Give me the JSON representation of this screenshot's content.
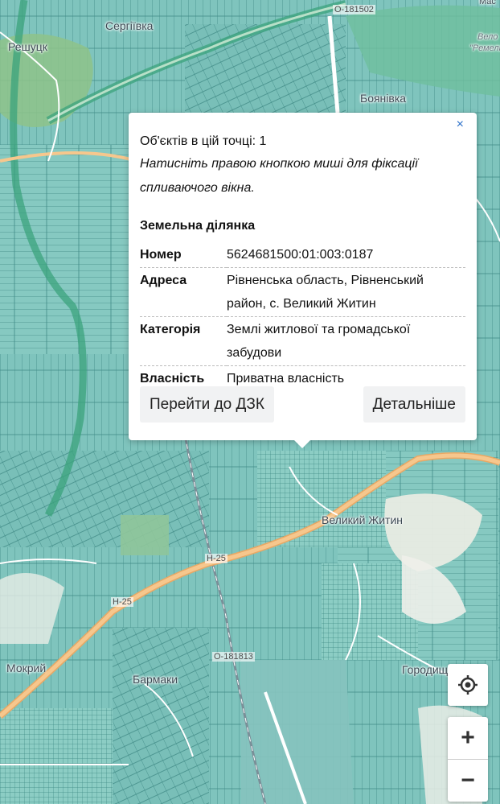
{
  "popup": {
    "close_label": "×",
    "count_text": "Об'єктів в цій точці: 1",
    "hint_text": "Натисніть правою кнопкою миші для фіксації спливаючого вікна.",
    "section_title": "Земельна ділянка",
    "attributes": [
      {
        "key": "Номер",
        "value": "5624681500:01:003:0187"
      },
      {
        "key": "Адреса",
        "value": "Рівненська область, Рівненський район, с. Великий Житин"
      },
      {
        "key": "Категорія",
        "value": "Землі житлової та громадської забудови"
      },
      {
        "key": "Власність",
        "value": "Приватна власність"
      }
    ],
    "buttons": {
      "go_dzk": "Перейти до ДЗК",
      "details": "Детальніше"
    }
  },
  "map": {
    "labels": {
      "serhiivka": "Сергіївка",
      "reshuk": "Решуцк",
      "boianivka": "Боянівка",
      "velykyi_zhytyn": "Великий Житин",
      "mokryi": "Мокрий",
      "barmaky": "Бармаки",
      "horodyshche": "Городище",
      "velo_top": "Вело",
      "remel": "\"Ремель",
      "mas": "Мас"
    },
    "road_labels": {
      "o181502": "О-181502",
      "h25_a": "Н-25",
      "h25_b": "Н-25",
      "o181813": "О-181813"
    },
    "colors": {
      "parcel_fill": "#7fc4bd",
      "parcel_line": "#3f8a86",
      "forest": "#84b87a",
      "road_major": "#f6c78d",
      "railway": "#8aa0a8",
      "canal": "#3ba37c"
    }
  },
  "controls": {
    "locate_icon": "locate-icon",
    "zoom_in": "+",
    "zoom_out": "−"
  }
}
